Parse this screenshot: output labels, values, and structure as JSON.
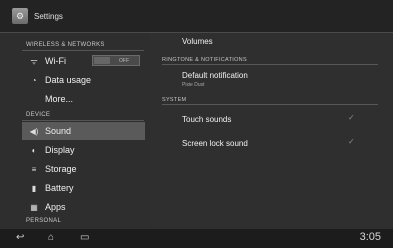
{
  "window": {
    "title": "Settings",
    "app_icon": "settings-icon"
  },
  "left_pane": {
    "sections": [
      {
        "header": "WIRELESS & NETWORKS"
      },
      {
        "header": "DEVICE"
      },
      {
        "header": "PERSONAL"
      }
    ],
    "items": [
      {
        "label": "Wi-Fi",
        "icon": "wifi-icon",
        "toggle": "OFF"
      },
      {
        "label": "Data usage",
        "icon": "data-usage-icon"
      },
      {
        "label": "More..."
      },
      {
        "label": "Sound",
        "icon": "sound-icon",
        "selected": true
      },
      {
        "label": "Display",
        "icon": "display-icon"
      },
      {
        "label": "Storage",
        "icon": "storage-icon"
      },
      {
        "label": "Battery",
        "icon": "battery-icon"
      },
      {
        "label": "Apps",
        "icon": "apps-icon"
      }
    ]
  },
  "right_pane": {
    "volumes": "Volumes",
    "ringtone_header": "RINGTONE & NOTIFICATIONS",
    "default_notification": {
      "label": "Default notification",
      "value": "Pixie Dust"
    },
    "system_header": "SYSTEM",
    "touch_sounds": {
      "label": "Touch sounds",
      "checked": true
    },
    "screen_lock_sound": {
      "label": "Screen lock sound",
      "checked": true
    }
  },
  "system_bar": {
    "buttons": [
      "back-icon",
      "home-icon",
      "recent-apps-icon"
    ],
    "time": "3:05"
  }
}
